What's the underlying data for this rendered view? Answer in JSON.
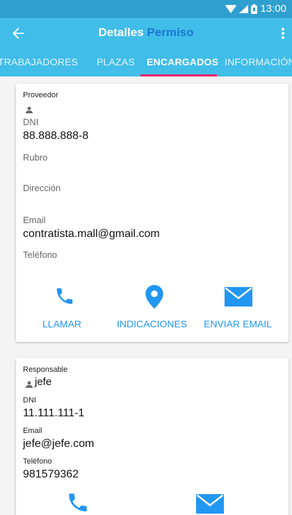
{
  "status_bar": {
    "time": "13:00"
  },
  "app_bar": {
    "title_part1": "Detalles",
    "title_part2": "Permiso"
  },
  "tabs": [
    {
      "label": "TRABAJADORES"
    },
    {
      "label": "PLAZAS"
    },
    {
      "label": "ENCARGADOS"
    },
    {
      "label": "INFORMACIÓN"
    }
  ],
  "proveedor": {
    "heading": "Proveedor",
    "dni_label": "DNI",
    "dni_value": "88.888.888-8",
    "rubro_label": "Rubro",
    "direccion_label": "Dirección",
    "email_label": "Email",
    "email_value": "contratista.mall@gmail.com",
    "telefono_label": "Teléfono",
    "actions": {
      "call": "LLAMAR",
      "directions": "INDICACIONES",
      "email": "ENVIAR EMAIL"
    }
  },
  "responsable": {
    "heading": "Responsable",
    "name": "jefe",
    "dni_label": "DNI",
    "dni_value": "11.111.111-1",
    "email_label": "Email",
    "email_value": "jefe@jefe.com",
    "telefono_label": "Teléfono",
    "telefono_value": "981579362"
  },
  "colors": {
    "primary": "#40bde8",
    "statusbar": "#2f9fd0",
    "accent": "#e91e63",
    "action_blue": "#2196f3"
  }
}
